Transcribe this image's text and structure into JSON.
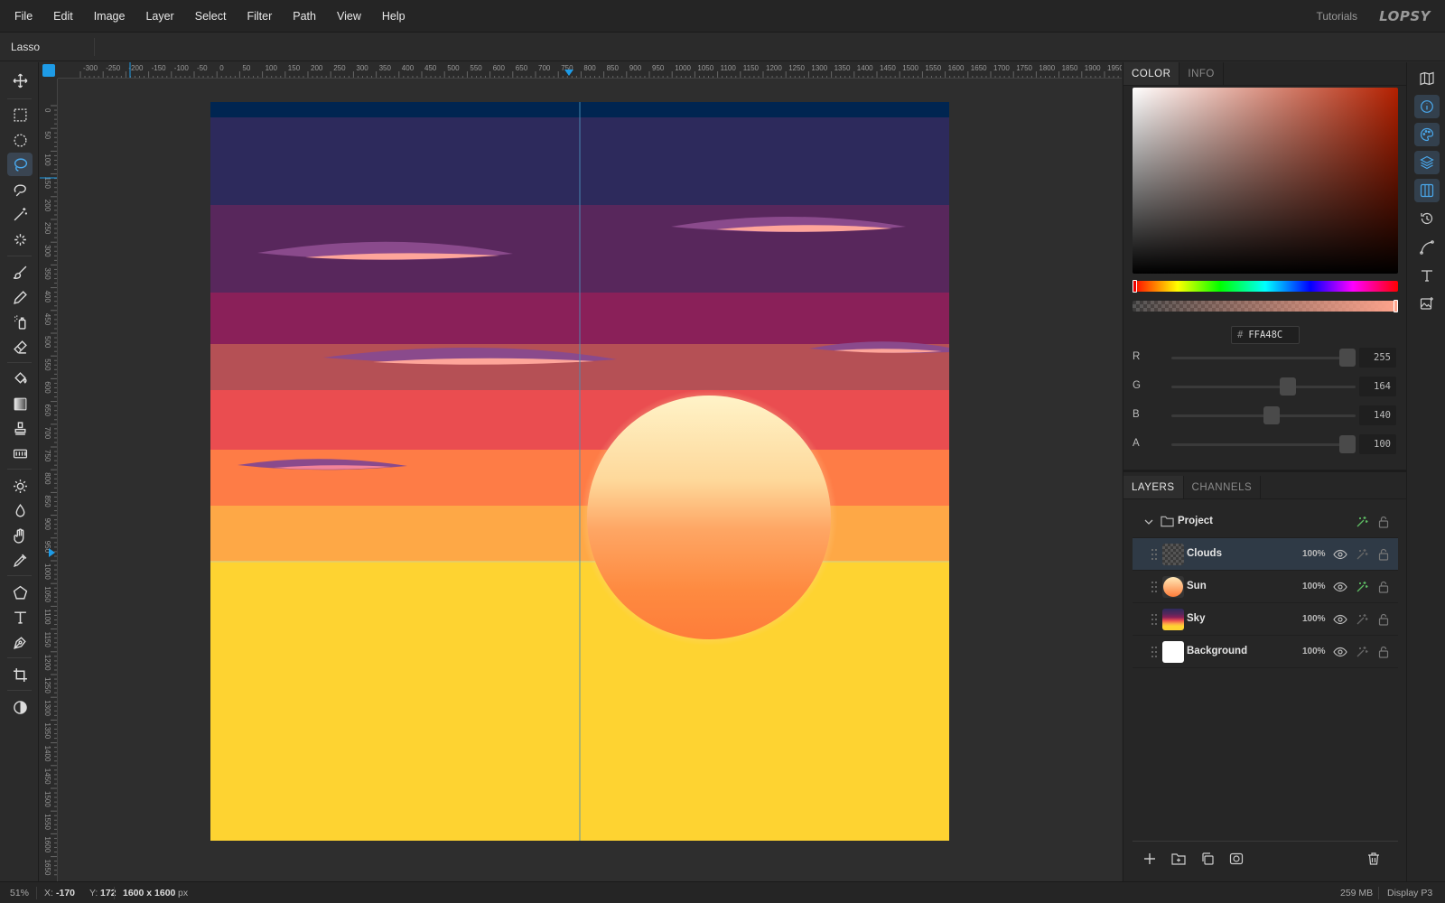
{
  "menu": {
    "items": [
      "File",
      "Edit",
      "Image",
      "Layer",
      "Select",
      "Filter",
      "Path",
      "View",
      "Help"
    ],
    "tutorials": "Tutorials",
    "logo": "LOPSY"
  },
  "options": {
    "tool_name": "Lasso"
  },
  "toolbar": {
    "tools": [
      "move-icon",
      "rect-select-icon",
      "ellipse-select-icon",
      "lasso-icon",
      "magnetic-lasso-icon",
      "magic-wand-icon",
      "object-select-icon",
      "brush-icon",
      "pencil-icon",
      "spray-icon",
      "eraser-icon",
      "fill-bucket-icon",
      "gradient-icon",
      "stamp-icon",
      "pattern-icon",
      "sharpen-icon",
      "blur-icon",
      "smudge-icon",
      "eyedropper-icon",
      "polygon-icon",
      "text-icon",
      "pen-icon",
      "crop-icon",
      "contrast-icon"
    ],
    "active": "lasso-icon"
  },
  "ruler": {
    "h_labels": [
      "-300",
      "-250",
      "-200",
      "-150",
      "-100",
      "-50",
      "0",
      "50",
      "100",
      "150",
      "200",
      "250",
      "300",
      "350",
      "400",
      "450",
      "500",
      "550",
      "600",
      "650",
      "700",
      "750",
      "800",
      "850",
      "900",
      "950",
      "1000",
      "1050",
      "1100",
      "1150",
      "1200",
      "1250",
      "1300",
      "1350",
      "1400",
      "1450",
      "1500",
      "1550",
      "1600",
      "1650",
      "1700",
      "1750",
      "1800",
      "1850",
      "1900",
      "1950"
    ],
    "v_labels": [
      "0",
      "50",
      "100",
      "150",
      "200",
      "250",
      "300",
      "350",
      "400",
      "450",
      "500",
      "550",
      "600",
      "650",
      "700",
      "750",
      "800",
      "850",
      "900",
      "950",
      "1000",
      "1050",
      "1100",
      "1150",
      "1200",
      "1250",
      "1300",
      "1350",
      "1400",
      "1450",
      "1500",
      "1550",
      "1600",
      "1650"
    ]
  },
  "color_panel": {
    "tabs": [
      "COLOR",
      "INFO"
    ],
    "hex": "FFA48C",
    "hash": "#",
    "channels": [
      {
        "label": "R",
        "value": "255"
      },
      {
        "label": "G",
        "value": "164"
      },
      {
        "label": "B",
        "value": "140"
      },
      {
        "label": "A",
        "value": "100"
      }
    ],
    "channel_levels": [
      1.0,
      0.643,
      0.549,
      1.0
    ]
  },
  "layers_panel": {
    "tabs": [
      "LAYERS",
      "CHANNELS"
    ],
    "group": "Project",
    "layers": [
      {
        "name": "Clouds",
        "opacity": "100%",
        "selected": true
      },
      {
        "name": "Sun",
        "opacity": "100%",
        "selected": false
      },
      {
        "name": "Sky",
        "opacity": "100%",
        "selected": false
      },
      {
        "name": "Background",
        "opacity": "100%",
        "selected": false
      }
    ]
  },
  "status": {
    "zoom": "51%",
    "x_label": "X:",
    "x_value": "-170",
    "y_label": "Y:",
    "y_value": "172",
    "doc_size": "1600 x 1600",
    "doc_unit": "px",
    "memory": "259 MB",
    "color_profile": "Display P3"
  },
  "colors": {
    "accent": "#1e9be6",
    "sky_top": "#2d2a5c",
    "ground": "#fed331",
    "sun_top": "#fff1c4",
    "sun_bottom": "#fe7d3a"
  }
}
